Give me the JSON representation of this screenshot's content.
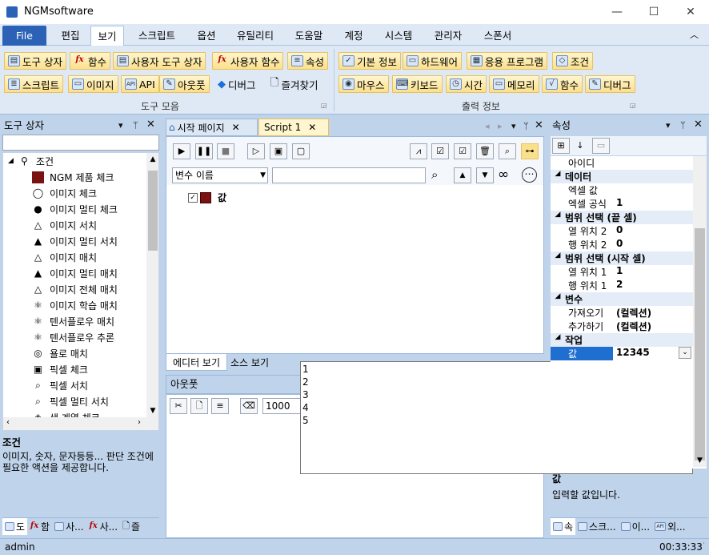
{
  "app_title": "NGMsoftware",
  "window_controls": {
    "minimize": "—",
    "maximize": "☐",
    "close": "✕"
  },
  "ribbon_tabs": [
    "File",
    "편집",
    "보기",
    "스크립트",
    "옵션",
    "유틸리티",
    "도움말",
    "계정",
    "시스템",
    "관리자",
    "스폰서"
  ],
  "ribbon": {
    "group1": {
      "label": "도구 모음",
      "row1": [
        "도구 상자",
        "함수",
        "사용자 도구 상자",
        "사용자 함수",
        "속성"
      ],
      "row2": [
        "스크립트",
        "이미지",
        "API",
        "아웃풋",
        "디버그",
        "즐겨찾기"
      ]
    },
    "group2": {
      "label": "출력 정보",
      "row1": [
        "기본 정보",
        "하드웨어",
        "응용 프로그램",
        "조건"
      ],
      "row2": [
        "마우스",
        "키보드",
        "시간",
        "메모리",
        "함수",
        "디버그"
      ]
    }
  },
  "toolbox": {
    "title": "도구 상자",
    "category": "조건",
    "items": [
      "NGM 제품 체크",
      "이미지 체크",
      "이미지 멀티 체크",
      "이미지 서치",
      "이미지 멀티 서치",
      "이미지 매치",
      "이미지 멀티 매치",
      "이미지 전체 매치",
      "이미지 학습 매치",
      "텐서플로우 매치",
      "텐서플로우 추론",
      "욜로 매치",
      "픽셀 체크",
      "픽셀 서치",
      "픽셀 멀티 서치",
      "색 계열 체크"
    ],
    "desc_title": "조건",
    "desc_text": "이미지, 숫자, 문자등등... 판단 조건에 필요한 액션을 제공합니다.",
    "bottom_tabs": [
      "도",
      "함",
      "사...",
      "사...",
      "즐"
    ]
  },
  "editor": {
    "tabs": [
      "시작 페이지",
      "Script 1"
    ],
    "var_select": "변수 이름",
    "search_value": "",
    "node_label": "값",
    "view_tabs": [
      "에디터 보기",
      "소스 보기"
    ]
  },
  "output": {
    "title": "아웃풋",
    "interval": "1000"
  },
  "dropdown_items": [
    "1",
    "2",
    "3",
    "4",
    "5"
  ],
  "properties": {
    "title": "속성",
    "rows": [
      {
        "type": "item",
        "name": "아이디",
        "value": ""
      },
      {
        "type": "cat",
        "name": "데이터"
      },
      {
        "type": "item",
        "name": "엑셀 값",
        "value": ""
      },
      {
        "type": "item",
        "name": "엑셀 공식",
        "value": "1"
      },
      {
        "type": "cat",
        "name": "범위 선택 (끝 셀)"
      },
      {
        "type": "item",
        "name": "열 위치 2",
        "value": "0"
      },
      {
        "type": "item",
        "name": "행 위치 2",
        "value": "0"
      },
      {
        "type": "cat",
        "name": "범위 선택 (시작 셀)"
      },
      {
        "type": "item",
        "name": "열 위치 1",
        "value": "1"
      },
      {
        "type": "item",
        "name": "행 위치 1",
        "value": "2"
      },
      {
        "type": "cat",
        "name": "변수"
      },
      {
        "type": "item",
        "name": "가져오기",
        "value": "(컬렉션)"
      },
      {
        "type": "item",
        "name": "추가하기",
        "value": "(컬렉션)"
      },
      {
        "type": "cat",
        "name": "작업"
      },
      {
        "type": "sel",
        "name": "값",
        "value": "12345"
      }
    ],
    "desc_title": "값",
    "desc_text": "입력할 값입니다.",
    "bottom_tabs": [
      "속",
      "스크...",
      "이...",
      "외..."
    ]
  },
  "status": {
    "user": "admin",
    "time": "00:33:33"
  }
}
